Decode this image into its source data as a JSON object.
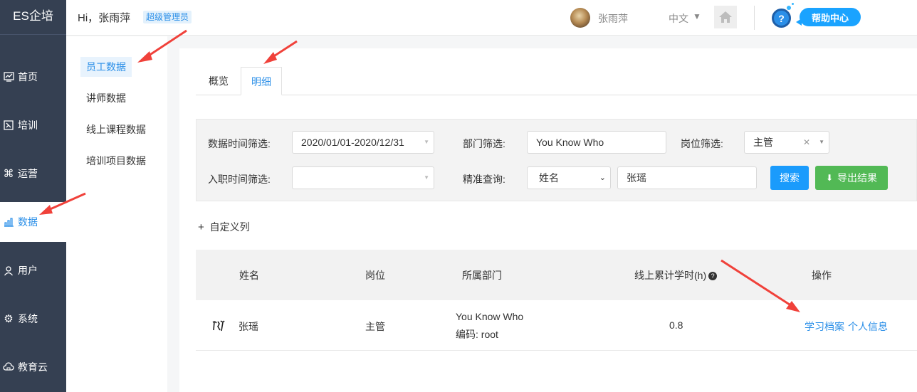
{
  "sidebar": {
    "brand": "ES企培",
    "items": [
      {
        "label": "首页",
        "icon": "chart-icon"
      },
      {
        "label": "培训",
        "icon": "training-icon"
      },
      {
        "label": "运营",
        "icon": "command-icon"
      },
      {
        "label": "数据",
        "icon": "data-icon",
        "active": true
      },
      {
        "label": "用户",
        "icon": "user-icon"
      },
      {
        "label": "系统",
        "icon": "gear-icon"
      },
      {
        "label": "教育云",
        "icon": "cloud-icon"
      }
    ]
  },
  "header": {
    "greeting": "Hi，张雨萍",
    "badge": "超级管理员",
    "user_name": "张雨萍",
    "language": "中文",
    "help_label": "帮助中心"
  },
  "subnav": {
    "items": [
      {
        "label": "员工数据",
        "active": true
      },
      {
        "label": "讲师数据"
      },
      {
        "label": "线上课程数据"
      },
      {
        "label": "培训项目数据"
      }
    ]
  },
  "tabs": [
    {
      "label": "概览"
    },
    {
      "label": "明细",
      "active": true
    }
  ],
  "filters": {
    "date_label": "数据时间筛选:",
    "date_value": "2020/01/01-2020/12/31",
    "dept_label": "部门筛选:",
    "dept_value": "You Know Who",
    "position_label": "岗位筛选:",
    "position_value": "主管",
    "hire_label": "入职时间筛选:",
    "hire_value": "",
    "precise_label": "精准查询:",
    "precise_field": "姓名",
    "precise_value": "张瑶",
    "search_button": "搜索",
    "export_button": "导出结果"
  },
  "custom_column": "自定义列",
  "table": {
    "headers": {
      "name": "姓名",
      "position": "岗位",
      "department": "所属部门",
      "hours": "线上累计学时(h)",
      "actions": "操作"
    },
    "rows": [
      {
        "name": "张瑶",
        "position": "主管",
        "department": "You Know Who",
        "code": "编码: root",
        "hours": "0.8",
        "action1": "学习档案",
        "action2": "个人信息"
      }
    ]
  },
  "colors": {
    "sidebar_bg": "#354052",
    "accent": "#2b8fe8",
    "export_green": "#52b955",
    "arrow_red": "#f0413a"
  }
}
